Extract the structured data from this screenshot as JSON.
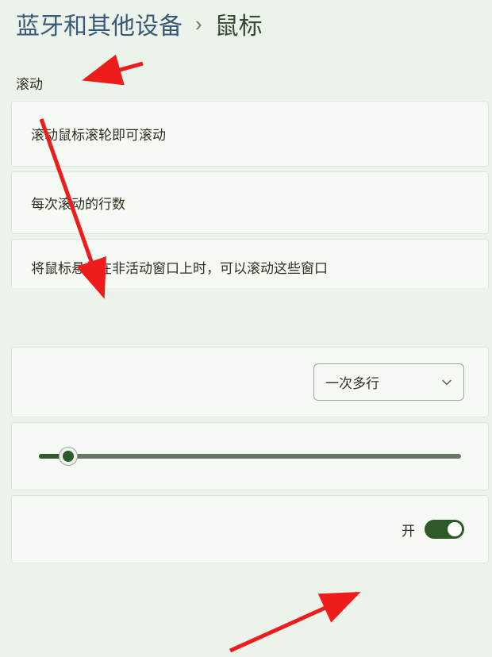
{
  "breadcrumb": {
    "parent": "蓝牙和其他设备",
    "separator": "›",
    "current": "鼠标"
  },
  "section": {
    "title": "滚动"
  },
  "rows": {
    "scroll_wheel": "滚动鼠标滚轮即可滚动",
    "lines_per_scroll": "每次滚动的行数",
    "hover_inactive": "将鼠标悬停在非活动窗口上时，可以滚动这些窗口"
  },
  "dropdown": {
    "selected": "一次多行"
  },
  "toggle": {
    "label": "开",
    "state": "on"
  },
  "colors": {
    "accent": "#2e5a2a",
    "arrow": "#ef1c1c"
  }
}
